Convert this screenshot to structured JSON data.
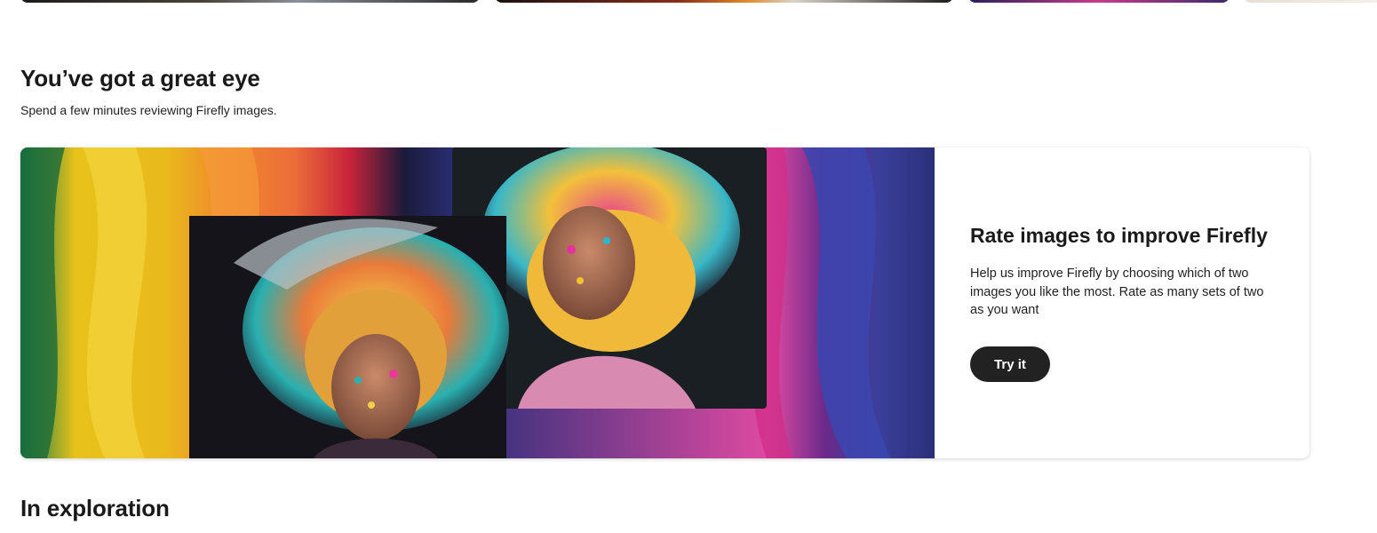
{
  "top_strip": {
    "thumbnails": [
      {
        "name": "thumbnail-1"
      },
      {
        "name": "thumbnail-2"
      },
      {
        "name": "thumbnail-3"
      },
      {
        "name": "thumbnail-4"
      }
    ]
  },
  "section_great_eye": {
    "title": "You’ve got a great eye",
    "subtitle": "Spend a few minutes reviewing Firefly images."
  },
  "rate_card": {
    "title": "Rate images to improve Firefly",
    "description": "Help us improve Firefly by choosing which of two images you like the most. Rate as many sets of two as you want",
    "button_label": "Try it",
    "button_color": "#222222"
  },
  "section_exploration": {
    "title": "In exploration"
  },
  "colors": {
    "background": "#ffffff",
    "text": "#1a1a1a"
  }
}
